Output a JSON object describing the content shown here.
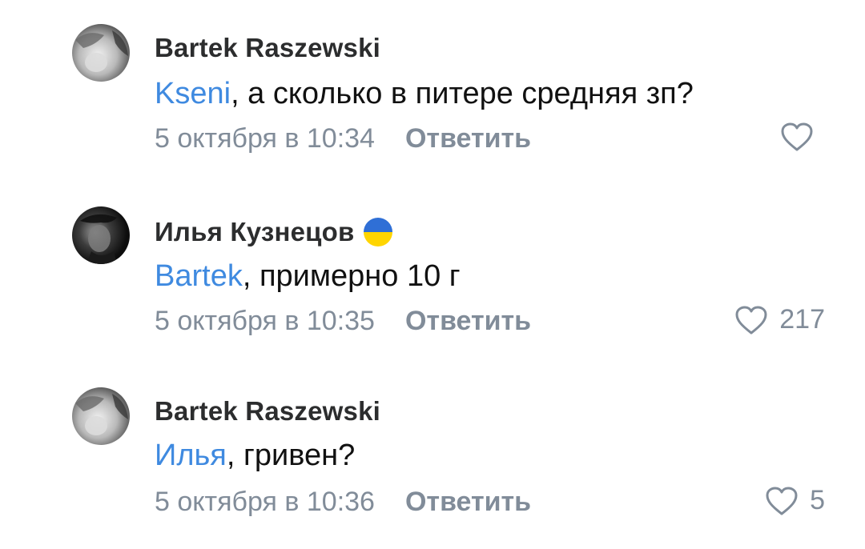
{
  "comments": [
    {
      "author": "Bartek Raszewski",
      "mention": "Kseni",
      "text": ", а сколько в питере средняя зп?",
      "date": "5 октября в 10:34",
      "reply_label": "Ответить",
      "likes": ""
    },
    {
      "author": "Илья Кузнецов",
      "mention": "Bartek",
      "text": ", примерно 10 г",
      "date": "5 октября в 10:35",
      "reply_label": "Ответить",
      "likes": "217"
    },
    {
      "author": "Bartek Raszewski",
      "mention": "Илья",
      "text": ", гривен?",
      "date": "5 октября в 10:36",
      "reply_label": "Ответить",
      "likes": "5"
    }
  ],
  "colors": {
    "mention": "#3f8ae0",
    "secondary": "#818c99",
    "author": "#2c2d2e",
    "flag_top": "#2f6fd6",
    "flag_bottom": "#ffd500"
  },
  "icons": {
    "like": "heart-outline-icon",
    "flag": "ukraine-flag-icon"
  }
}
